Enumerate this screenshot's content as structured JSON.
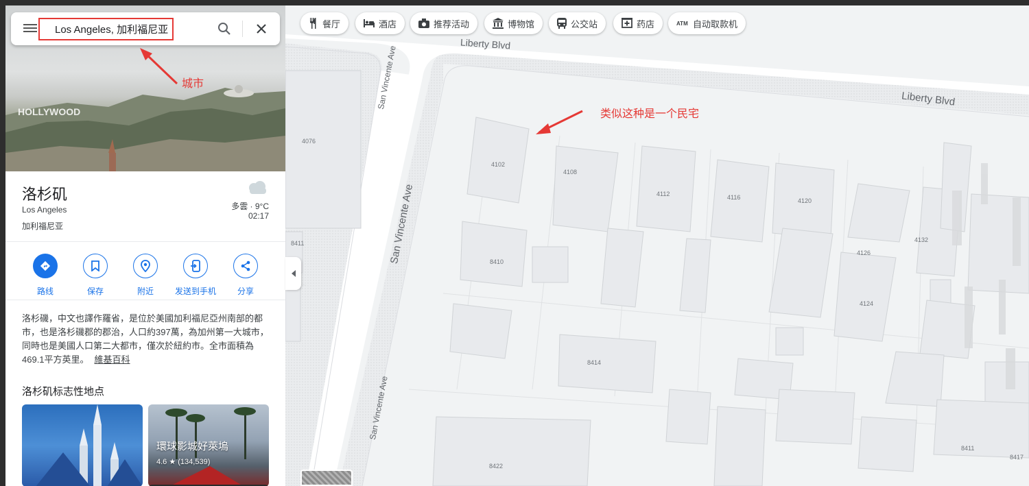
{
  "search": {
    "value": "Los Angeles, 加利福尼亚"
  },
  "place": {
    "title": "洛杉矶",
    "subtitle": "Los Angeles",
    "region": "加利福尼亚",
    "weather": "多雲 · 9°C",
    "time": "02:17"
  },
  "actions": [
    {
      "label": "路线",
      "icon": "directions-icon"
    },
    {
      "label": "保存",
      "icon": "bookmark-icon"
    },
    {
      "label": "附近",
      "icon": "nearby-icon"
    },
    {
      "label": "发送到手机",
      "icon": "send-to-phone-icon"
    },
    {
      "label": "分享",
      "icon": "share-icon"
    }
  ],
  "description": {
    "text": "洛杉磯，中文也譯作羅省，是位於美國加利福尼亞州南部的都市，也是洛杉磯郡的郡治，人口約397萬，為加州第一大城市，同時也是美國人口第二大都市，僅次於紐約市。全市面積為469.1平方英里。",
    "link": "維基百科"
  },
  "landmarks": {
    "title": "洛杉矶标志性地点",
    "cards": [
      {
        "title": "",
        "rating": ""
      },
      {
        "title": "環球影城好萊塢",
        "rating": "4.6 ★ (134,539)"
      }
    ]
  },
  "chips": [
    {
      "label": "餐厅",
      "icon": "restaurant-icon"
    },
    {
      "label": "酒店",
      "icon": "hotel-icon"
    },
    {
      "label": "推荐活动",
      "icon": "camera-icon"
    },
    {
      "label": "博物馆",
      "icon": "museum-icon"
    },
    {
      "label": "公交站",
      "icon": "transit-icon"
    },
    {
      "label": "药店",
      "icon": "pharmacy-icon"
    },
    {
      "label": "自动取款机",
      "icon": "atm-icon"
    }
  ],
  "map": {
    "streets": [
      "Liberty Blvd",
      "Liberty Blvd",
      "San Vincente Ave",
      "San Vincente Ave",
      "San Vincente Ave"
    ],
    "street_partial": "Li",
    "numbers": [
      "4076",
      "4102",
      "4108",
      "4112",
      "4116",
      "4120",
      "4126",
      "4132",
      "4124",
      "8411",
      "8410",
      "8414",
      "8422",
      "8411",
      "8417"
    ]
  },
  "annotations": {
    "city": "城市",
    "house": "类似这种是一个民宅",
    "color": "#e53935"
  }
}
